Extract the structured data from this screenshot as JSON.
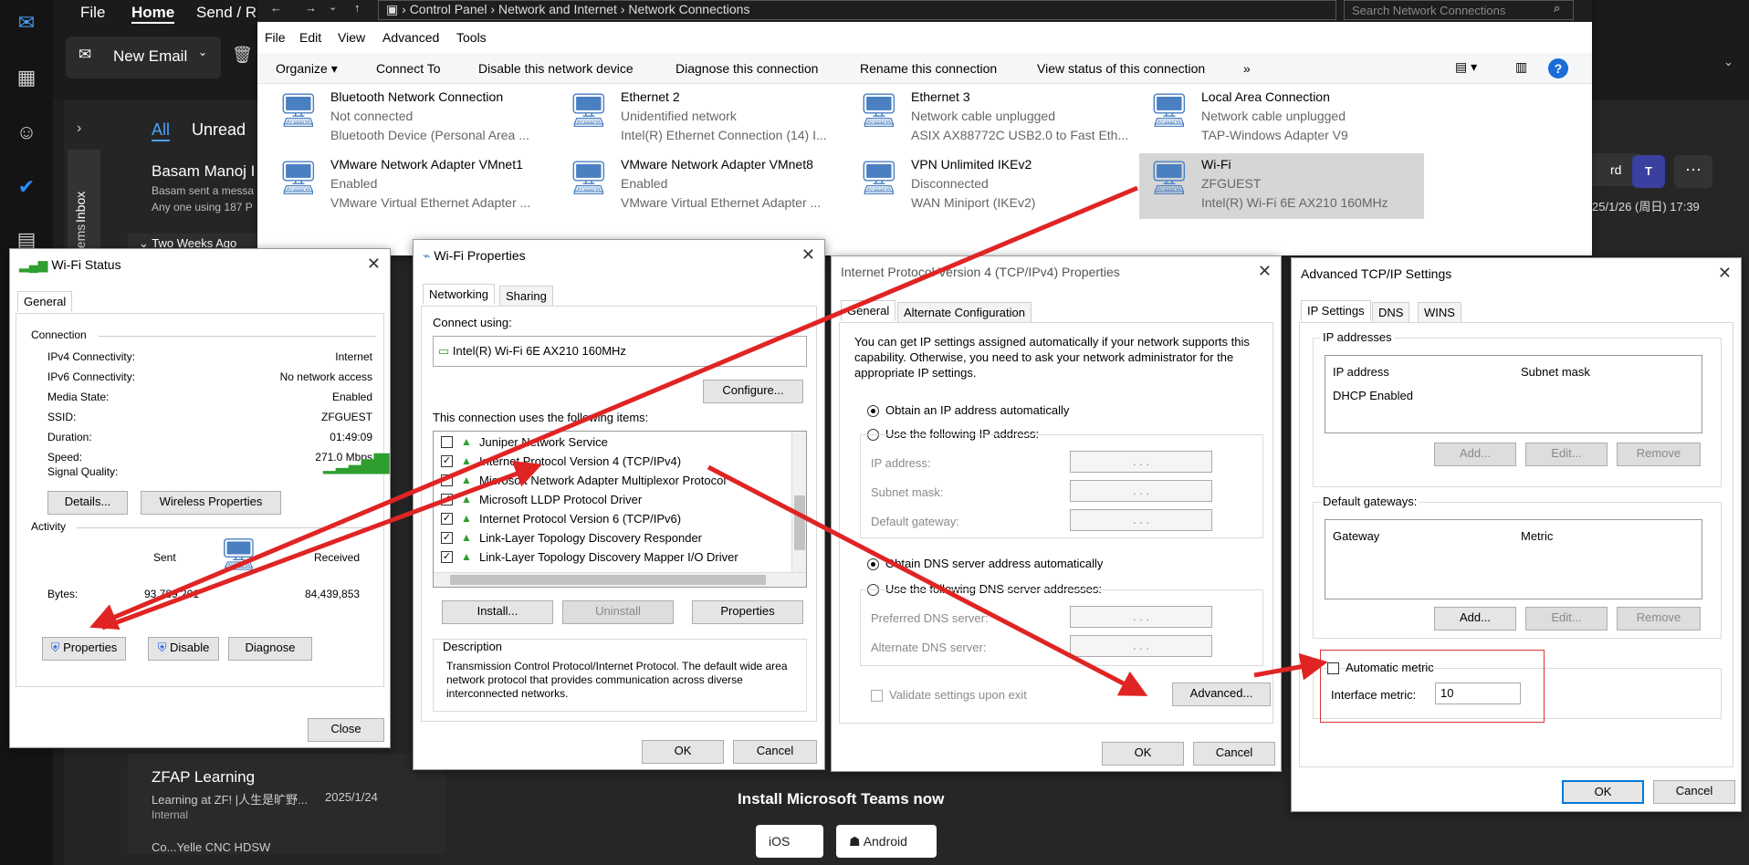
{
  "outlook": {
    "menu_file": "File",
    "menu_home": "Home",
    "menu_send": "Send / R",
    "new_email": "New Email",
    "filter_all": "All",
    "filter_unread": "Unread",
    "inbox": "Inbox",
    "items": "Items",
    "sender1": "Basam Manoj I",
    "sender1_preview": "Basam sent a messa",
    "sender1_preview2": "Any one using 187 P",
    "group_header": "Two Weeks Ago",
    "sender2": "ZFAP Learning",
    "sender2_preview": "Learning at ZF! |人生是旷野...",
    "sender2_date": "2025/1/24",
    "sender2_tag": "Internal",
    "sender3": "Co...Yelle CNC HDSW",
    "reply_btn": "rd",
    "date_label": "25/1/26 (周日) 17:39",
    "teams_title": "Install Microsoft Teams now",
    "ios": "iOS",
    "android": "Android",
    "accent": "#0f6cbd"
  },
  "netconn": {
    "breadcrumb": [
      "Control Panel",
      "Network and Internet",
      "Network Connections"
    ],
    "search_placeholder": "Search Network Connections",
    "menu": [
      "File",
      "Edit",
      "View",
      "Advanced",
      "Tools"
    ],
    "toolbar": [
      "Organize",
      "Connect To",
      "Disable this network device",
      "Diagnose this connection",
      "Rename this connection",
      "View status of this connection",
      "»"
    ],
    "adapters": [
      {
        "name": "Bluetooth Network Connection",
        "status": "Not connected",
        "device": "Bluetooth Device (Personal Area ..."
      },
      {
        "name": "Ethernet 2",
        "status": "Unidentified network",
        "device": "Intel(R) Ethernet Connection (14) I..."
      },
      {
        "name": "Ethernet 3",
        "status": "Network cable unplugged",
        "device": "ASIX AX88772C USB2.0 to Fast Eth..."
      },
      {
        "name": "Local Area Connection",
        "status": "Network cable unplugged",
        "device": "TAP-Windows Adapter V9"
      },
      {
        "name": "VMware Network Adapter VMnet1",
        "status": "Enabled",
        "device": "VMware Virtual Ethernet Adapter ..."
      },
      {
        "name": "VMware Network Adapter VMnet8",
        "status": "Enabled",
        "device": "VMware Virtual Ethernet Adapter ..."
      },
      {
        "name": "VPN Unlimited IKEv2",
        "status": "Disconnected",
        "device": "WAN Miniport (IKEv2)"
      },
      {
        "name": "Wi-Fi",
        "status": "ZFGUEST",
        "device": "Intel(R) Wi-Fi 6E AX210 160MHz"
      }
    ]
  },
  "wifi_status": {
    "title": "Wi-Fi Status",
    "tab": "General",
    "connection": "Connection",
    "rows": [
      {
        "k": "IPv4 Connectivity:",
        "v": "Internet"
      },
      {
        "k": "IPv6 Connectivity:",
        "v": "No network access"
      },
      {
        "k": "Media State:",
        "v": "Enabled"
      },
      {
        "k": "SSID:",
        "v": "ZFGUEST"
      },
      {
        "k": "Duration:",
        "v": "01:49:09"
      },
      {
        "k": "Speed:",
        "v": "271.0 Mbps"
      }
    ],
    "signal": "Signal Quality:",
    "details": "Details...",
    "wireless": "Wireless Properties",
    "activity": "Activity",
    "sent": "Sent",
    "received": "Received",
    "bytes": "Bytes:",
    "sent_val": "93,789,201",
    "recv_val": "84,439,853",
    "properties": "Properties",
    "disable": "Disable",
    "diagnose": "Diagnose",
    "close": "Close"
  },
  "wifi_props": {
    "title": "Wi-Fi Properties",
    "tab_networking": "Networking",
    "tab_sharing": "Sharing",
    "connect_using": "Connect using:",
    "adapter": "Intel(R) Wi-Fi 6E AX210 160MHz",
    "configure": "Configure...",
    "items_label": "This connection uses the following items:",
    "items": [
      {
        "name": "Juniper Network Service",
        "checked": false
      },
      {
        "name": "Internet Protocol Version 4 (TCP/IPv4)",
        "checked": true
      },
      {
        "name": "Microsoft Network Adapter Multiplexor Protocol",
        "checked": false
      },
      {
        "name": "Microsoft LLDP Protocol Driver",
        "checked": true
      },
      {
        "name": "Internet Protocol Version 6 (TCP/IPv6)",
        "checked": true
      },
      {
        "name": "Link-Layer Topology Discovery Responder",
        "checked": true
      },
      {
        "name": "Link-Layer Topology Discovery Mapper I/O Driver",
        "checked": true
      }
    ],
    "install": "Install...",
    "uninstall": "Uninstall",
    "properties": "Properties",
    "description": "Description",
    "desc_text": "Transmission Control Protocol/Internet Protocol. The default wide area network protocol that provides communication across diverse interconnected networks.",
    "ok": "OK",
    "cancel": "Cancel"
  },
  "ipv4": {
    "title": "Internet Protocol Version 4 (TCP/IPv4) Properties",
    "tab_general": "General",
    "tab_alt": "Alternate Configuration",
    "intro": "You can get IP settings assigned automatically if your network supports this capability. Otherwise, you need to ask your network administrator for the appropriate IP settings.",
    "auto_ip": "Obtain an IP address automatically",
    "manual_ip": "Use the following IP address:",
    "ip": "IP address:",
    "mask": "Subnet mask:",
    "gateway": "Default gateway:",
    "auto_dns": "Obtain DNS server address automatically",
    "manual_dns": "Use the following DNS server addresses:",
    "pref_dns": "Preferred DNS server:",
    "alt_dns": "Alternate DNS server:",
    "ip_blank": ".      .      .",
    "validate": "Validate settings upon exit",
    "advanced": "Advanced...",
    "ok": "OK",
    "cancel": "Cancel"
  },
  "advanced": {
    "title": "Advanced TCP/IP Settings",
    "tab_ip": "IP Settings",
    "tab_dns": "DNS",
    "tab_wins": "WINS",
    "ip_addresses": "IP addresses",
    "col_ip": "IP address",
    "col_mask": "Subnet mask",
    "dhcp": "DHCP Enabled",
    "add": "Add...",
    "edit": "Edit...",
    "remove": "Remove",
    "gateways": "Default gateways:",
    "col_gateway": "Gateway",
    "col_metric": "Metric",
    "auto_metric": "Automatic metric",
    "iface_metric": "Interface metric:",
    "metric_val": "10",
    "ok": "OK",
    "cancel": "Cancel"
  }
}
